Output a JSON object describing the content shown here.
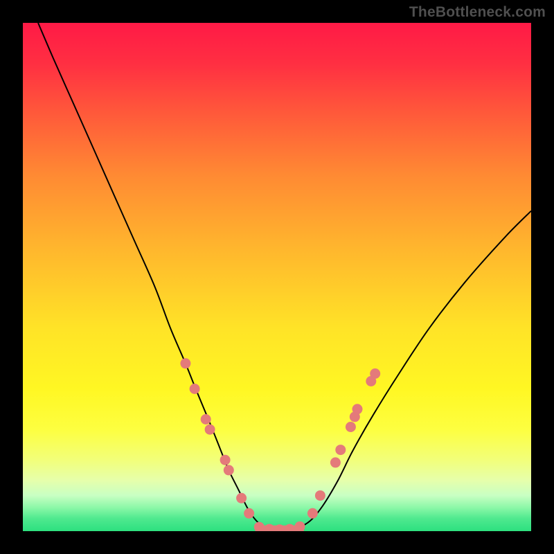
{
  "watermark": "TheBottleneck.com",
  "colors": {
    "curve_stroke": "#000000",
    "dot_fill": "#e47a7a",
    "frame_bg": "#000000"
  },
  "gradient_stops": [
    {
      "offset": 0.0,
      "color": "#ff1a46"
    },
    {
      "offset": 0.08,
      "color": "#ff2f42"
    },
    {
      "offset": 0.18,
      "color": "#ff5a3a"
    },
    {
      "offset": 0.3,
      "color": "#ff8a33"
    },
    {
      "offset": 0.45,
      "color": "#ffb82d"
    },
    {
      "offset": 0.6,
      "color": "#ffe327"
    },
    {
      "offset": 0.72,
      "color": "#fff723"
    },
    {
      "offset": 0.8,
      "color": "#fdff40"
    },
    {
      "offset": 0.86,
      "color": "#f2ff7a"
    },
    {
      "offset": 0.9,
      "color": "#e6ffab"
    },
    {
      "offset": 0.93,
      "color": "#c8ffc3"
    },
    {
      "offset": 0.955,
      "color": "#88f7a6"
    },
    {
      "offset": 0.975,
      "color": "#4fe98f"
    },
    {
      "offset": 1.0,
      "color": "#2de07f"
    }
  ],
  "chart_data": {
    "type": "line",
    "title": "",
    "xlabel": "",
    "ylabel": "",
    "xlim": [
      0,
      100
    ],
    "ylim": [
      0,
      100
    ],
    "series": [
      {
        "name": "bottleneck-curve",
        "x": [
          3,
          6,
          10,
          14,
          18,
          22,
          26,
          29,
          32,
          34,
          36.5,
          38.5,
          40.5,
          42.5,
          44.5,
          46.5,
          48.5,
          50,
          52,
          54,
          56.5,
          59,
          62,
          65,
          69,
          74,
          80,
          87,
          95,
          100
        ],
        "y": [
          100,
          93,
          84,
          75,
          66,
          57,
          48,
          40,
          33,
          28,
          22,
          17,
          12,
          8,
          4,
          1.5,
          0.5,
          0.3,
          0.3,
          0.6,
          2,
          5,
          10,
          16,
          23,
          31,
          40,
          49,
          58,
          63
        ]
      }
    ],
    "scatter": {
      "name": "markers",
      "points": [
        {
          "x": 32.0,
          "y": 33.0
        },
        {
          "x": 33.8,
          "y": 28.0
        },
        {
          "x": 36.0,
          "y": 22.0
        },
        {
          "x": 36.8,
          "y": 20.0
        },
        {
          "x": 39.8,
          "y": 14.0
        },
        {
          "x": 40.5,
          "y": 12.0
        },
        {
          "x": 43.0,
          "y": 6.5
        },
        {
          "x": 44.5,
          "y": 3.5
        },
        {
          "x": 46.5,
          "y": 0.8
        },
        {
          "x": 48.5,
          "y": 0.4
        },
        {
          "x": 50.5,
          "y": 0.3
        },
        {
          "x": 52.5,
          "y": 0.4
        },
        {
          "x": 54.5,
          "y": 0.9
        },
        {
          "x": 57.0,
          "y": 3.5
        },
        {
          "x": 58.5,
          "y": 7.0
        },
        {
          "x": 61.5,
          "y": 13.5
        },
        {
          "x": 62.5,
          "y": 16.0
        },
        {
          "x": 64.5,
          "y": 20.5
        },
        {
          "x": 65.3,
          "y": 22.5
        },
        {
          "x": 65.8,
          "y": 24.0
        },
        {
          "x": 68.5,
          "y": 29.5
        },
        {
          "x": 69.3,
          "y": 31.0
        }
      ]
    }
  }
}
